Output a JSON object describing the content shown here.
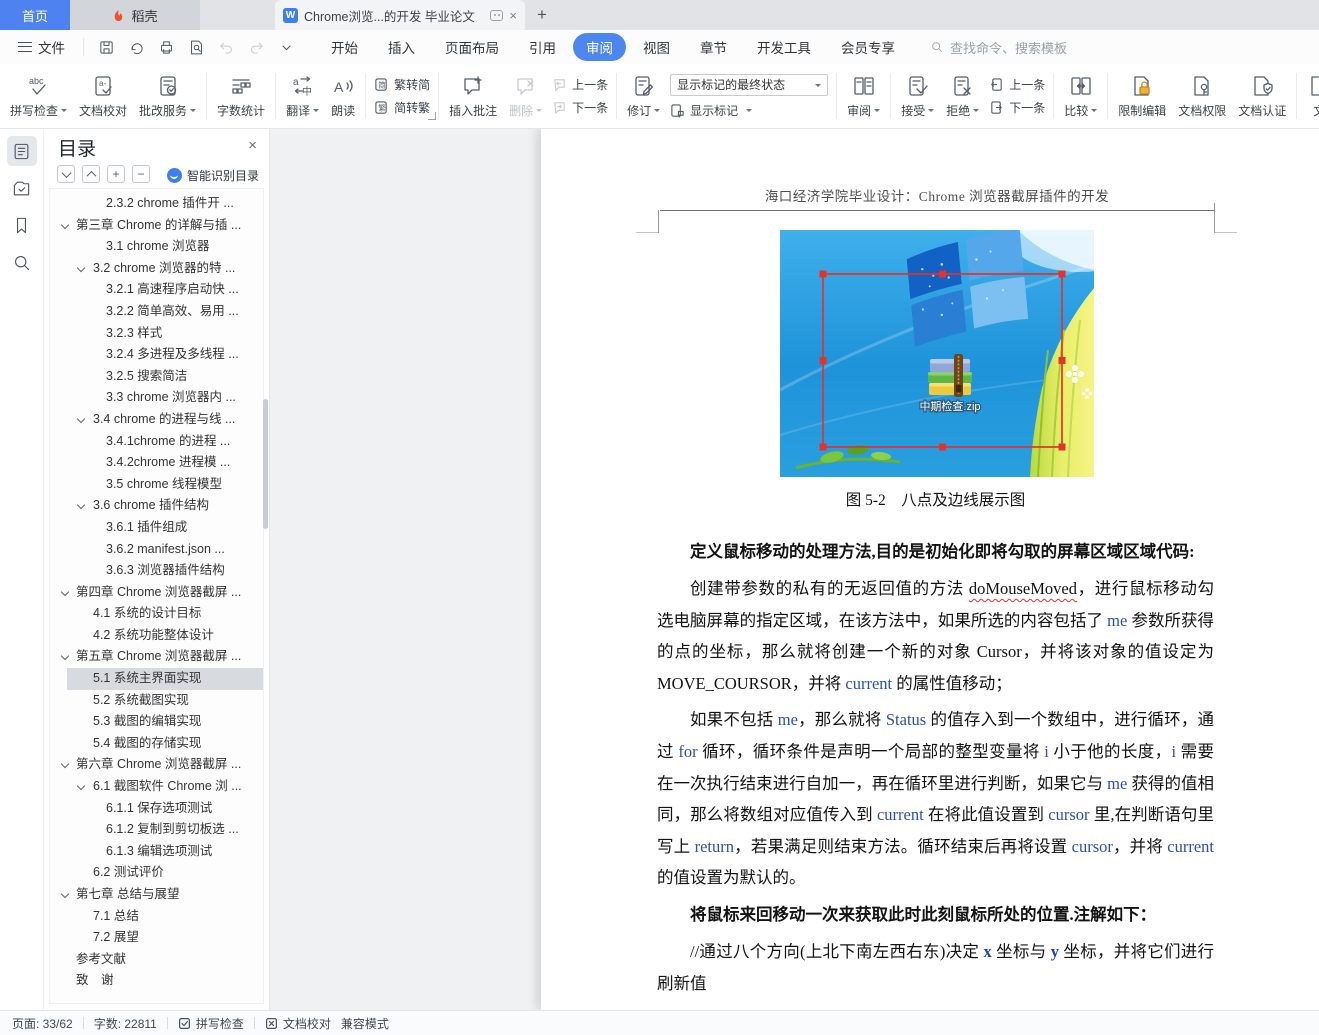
{
  "icons": {
    "close": "×",
    "plus": "+",
    "minus": "−",
    "new_tab": "+"
  },
  "tabbar": {
    "home": "首页",
    "docer": "稻壳",
    "doc_title": "Chrome浏览...的开发 毕业论文"
  },
  "menubar": {
    "file": "文件",
    "tabs": [
      {
        "label": "开始"
      },
      {
        "label": "插入"
      },
      {
        "label": "页面布局"
      },
      {
        "label": "引用"
      },
      {
        "label": "审阅",
        "active": true
      },
      {
        "label": "视图"
      },
      {
        "label": "章节"
      },
      {
        "label": "开发工具"
      },
      {
        "label": "会员专享"
      }
    ],
    "search_placeholder": "查找命令、搜索模板"
  },
  "ribbon": {
    "spell": {
      "label": "拼写检查"
    },
    "proof": {
      "label": "文档校对"
    },
    "grade": {
      "label": "批改服务"
    },
    "wordcount": {
      "label": "字数统计"
    },
    "translate": {
      "label": "翻译"
    },
    "read": {
      "label": "朗读"
    },
    "t2s": {
      "label": "繁转简"
    },
    "s2t": {
      "label": "简转繁"
    },
    "comment": {
      "label": "插入批注"
    },
    "del": {
      "label": "删除"
    },
    "prev_comment": {
      "label": "上一条"
    },
    "next_comment": {
      "label": "下一条"
    },
    "revise": {
      "label": "修订"
    },
    "markup_state": {
      "value": "显示标记的最终状态"
    },
    "show_markup": {
      "label": "显示标记"
    },
    "review": {
      "label": "审阅"
    },
    "accept": {
      "label": "接受"
    },
    "reject": {
      "label": "拒绝"
    },
    "prev_rev": {
      "label": "上一条"
    },
    "next_rev": {
      "label": "下一条"
    },
    "compare": {
      "label": "比较"
    },
    "restrict": {
      "label": "限制编辑"
    },
    "permission": {
      "label": "文档权限"
    },
    "certify": {
      "label": "文档认证"
    },
    "clipped": {
      "label": "文"
    }
  },
  "sidebar": {
    "title": "目录",
    "smart": "智能识别目录"
  },
  "toc": {
    "items": [
      {
        "text": "2.3.2 chrome 插件开 ...",
        "indent": 2
      },
      {
        "text": "第三章  Chrome 的详解与插 ...",
        "indent": 0,
        "chevron": true
      },
      {
        "text": "3.1 chrome 浏览器",
        "indent": 2
      },
      {
        "text": "3.2 chrome 浏览器的特 ...",
        "indent": 1,
        "chevron": true
      },
      {
        "text": "3.2.1 高速程序启动快 ...",
        "indent": 2
      },
      {
        "text": "3.2.2 简单高效、易用 ...",
        "indent": 2
      },
      {
        "text": "3.2.3 样式",
        "indent": 2
      },
      {
        "text": "3.2.4 多进程及多线程 ...",
        "indent": 2
      },
      {
        "text": "3.2.5 搜索简洁",
        "indent": 2
      },
      {
        "text": "3.3 chrome 浏览器内 ...",
        "indent": 2
      },
      {
        "text": "3.4 chrome 的进程与线 ...",
        "indent": 1,
        "chevron": true
      },
      {
        "text": "3.4.1chrome 的进程 ...",
        "indent": 2
      },
      {
        "text": "3.4.2chrome 进程模 ...",
        "indent": 2
      },
      {
        "text": "3.5 chrome 线程模型",
        "indent": 2
      },
      {
        "text": "3.6 chrome 插件结构",
        "indent": 1,
        "chevron": true
      },
      {
        "text": "3.6.1 插件组成",
        "indent": 2
      },
      {
        "text": "3.6.2 manifest.json ...",
        "indent": 2
      },
      {
        "text": "3.6.3 浏览器插件结构",
        "indent": 2
      },
      {
        "text": "第四章  Chrome 浏览器截屏 ...",
        "indent": 0,
        "chevron": true
      },
      {
        "text": "4.1 系统的设计目标",
        "indent": 1
      },
      {
        "text": "4.2 系统功能整体设计",
        "indent": 1
      },
      {
        "text": "第五章  Chrome 浏览器截屏 ...",
        "indent": 0,
        "chevron": true
      },
      {
        "text": "5.1 系统主界面实现",
        "indent": 1,
        "selected": true
      },
      {
        "text": "5.2 系统截图实现",
        "indent": 1
      },
      {
        "text": "5.3 截图的编辑实现",
        "indent": 1
      },
      {
        "text": "5.4 截图的存储实现",
        "indent": 1
      },
      {
        "text": "第六章  Chrome 浏览器截屏 ...",
        "indent": 0,
        "chevron": true
      },
      {
        "text": "6.1 截图软件 Chrome 浏 ...",
        "indent": 1,
        "chevron": true
      },
      {
        "text": "6.1.1 保存选项测试",
        "indent": 2
      },
      {
        "text": "6.1.2 复制到剪切板选 ...",
        "indent": 2
      },
      {
        "text": "6.1.3 编辑选项测试",
        "indent": 2
      },
      {
        "text": "6.2 测试评价",
        "indent": 1
      },
      {
        "text": "第七章  总结与展望",
        "indent": 0,
        "chevron": true
      },
      {
        "text": "7.1 总结",
        "indent": 1
      },
      {
        "text": "7.2 展望",
        "indent": 1
      },
      {
        "text": "参考文献",
        "indent": 0
      },
      {
        "text": "致　谢",
        "indent": 0
      }
    ]
  },
  "document": {
    "header": "海口经济学院毕业设计：Chrome 浏览器截屏插件的开发",
    "image_caption_label": "中期检查.zip",
    "blocks": [
      {
        "kind": "caption",
        "segments": [
          {
            "t": "图 5-2　八点及边线展示图"
          }
        ]
      },
      {
        "kind": "heading",
        "segments": [
          {
            "t": "定义鼠标移动的处理方法,目的是初始化即将勾取的屏幕区域区域代码:"
          }
        ]
      },
      {
        "kind": "para",
        "segments": [
          {
            "t": "创建带参数的私有的无返回值的方法 "
          },
          {
            "t": "doMouseMoved",
            "cls": "err"
          },
          {
            "t": "，进行鼠标移动勾选电脑屏幕的指定区域，在该方法中，如果所选的内容包括了 "
          },
          {
            "t": "me",
            "cls": "en"
          },
          {
            "t": " 参数所获得的点的坐标，那么就将创建一个新的对象 "
          },
          {
            "t": "Cursor"
          },
          {
            "t": "，并将该对象的值设定为 "
          },
          {
            "t": "MOVE_COURSOR"
          },
          {
            "t": "，并将 "
          },
          {
            "t": "current",
            "cls": "en"
          },
          {
            "t": " 的属性值移动；"
          }
        ]
      },
      {
        "kind": "para",
        "segments": [
          {
            "t": "如果不包括 "
          },
          {
            "t": "me",
            "cls": "en"
          },
          {
            "t": "，那么就将 "
          },
          {
            "t": "Status",
            "cls": "en"
          },
          {
            "t": " 的值存入到一个数组中，进行循环，通过 "
          },
          {
            "t": "for",
            "cls": "en"
          },
          {
            "t": " 循环，循环条件是声明一个局部的整型变量将 "
          },
          {
            "t": "i",
            "cls": "en"
          },
          {
            "t": " 小于他的长度，"
          },
          {
            "t": "i",
            "cls": "en"
          },
          {
            "t": " 需要在一次执行结束进行自加一，再在循环里进行判断，如果它与 "
          },
          {
            "t": "me",
            "cls": "en"
          },
          {
            "t": " 获得的值相同，那么将数组对应值传入到 "
          },
          {
            "t": "current",
            "cls": "en"
          },
          {
            "t": " 在将此值设置到 "
          },
          {
            "t": "cursor",
            "cls": "en"
          },
          {
            "t": " 里,在判断语句里写上 "
          },
          {
            "t": "return",
            "cls": "en"
          },
          {
            "t": "，若果满足则结束方法。循环结束后再将设置 "
          },
          {
            "t": "cursor",
            "cls": "en"
          },
          {
            "t": "，并将 "
          },
          {
            "t": "current",
            "cls": "en"
          },
          {
            "t": " 的值设置为默认的。"
          }
        ]
      },
      {
        "kind": "heading",
        "segments": [
          {
            "t": "将鼠标来回移动一次来获取此时此刻鼠标所处的位置.注解如下："
          }
        ]
      },
      {
        "kind": "para",
        "segments": [
          {
            "t": "//通过八个方向(上北下南左西右东)决定 "
          },
          {
            "t": "x",
            "cls": "enb"
          },
          {
            "t": " 坐标与 "
          },
          {
            "t": "y",
            "cls": "enb"
          },
          {
            "t": " 坐标，并将它们进行刷新值"
          }
        ]
      }
    ]
  },
  "statusbar": {
    "page": "页面: 33/62",
    "words": "字数: 22811",
    "spell": "拼写检查",
    "proof": "文档校对",
    "mode": "兼容模式"
  }
}
